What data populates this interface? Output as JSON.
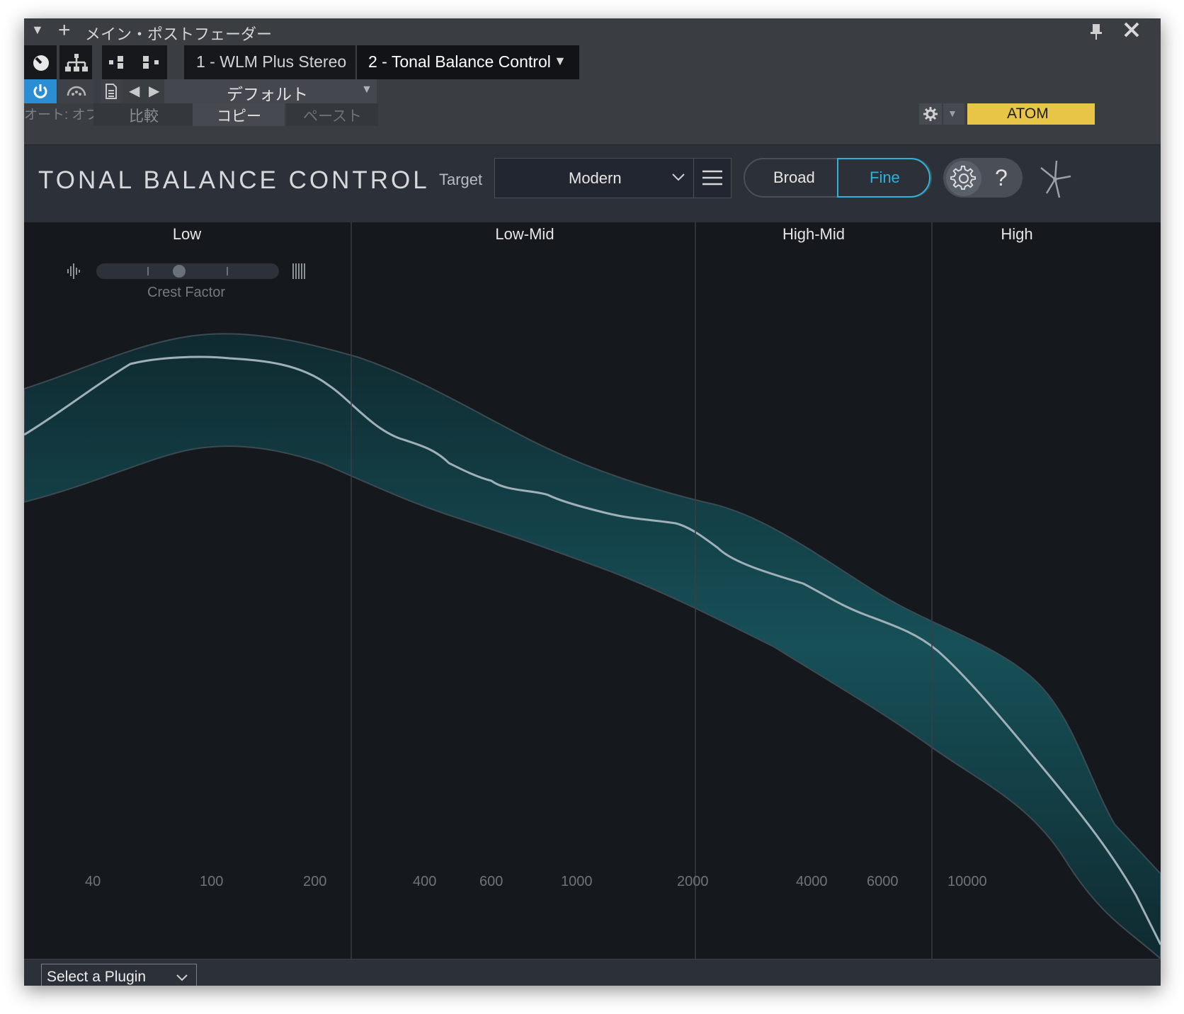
{
  "window": {
    "title": "メイン・ポストフェーダー",
    "slots": [
      {
        "label": "1 - WLM Plus Stereo"
      },
      {
        "label": "2 - Tonal Balance Control"
      }
    ],
    "preset": "デフォルト",
    "auto_label": "オート: オフ",
    "compare_label": "比較",
    "copy_label": "コピー",
    "paste_label": "ペースト",
    "atom_label": "ATOM",
    "atom_color": "#e8c547"
  },
  "plugin": {
    "title": "TONAL BALANCE CONTROL",
    "target_label": "Target",
    "target_value": "Modern",
    "broad_label": "Broad",
    "fine_label": "Fine",
    "help_label": "?",
    "accent_color": "#2bb3d9"
  },
  "bands": [
    {
      "label": "Low"
    },
    {
      "label": "Low-Mid"
    },
    {
      "label": "High-Mid"
    },
    {
      "label": "High"
    }
  ],
  "crest": {
    "label": "Crest Factor",
    "position": 0.45
  },
  "ticks": [
    "40",
    "100",
    "200",
    "400",
    "600",
    "1000",
    "2000",
    "4000",
    "6000",
    "10000"
  ],
  "footer": {
    "select_plugin": "Select a Plugin"
  }
}
